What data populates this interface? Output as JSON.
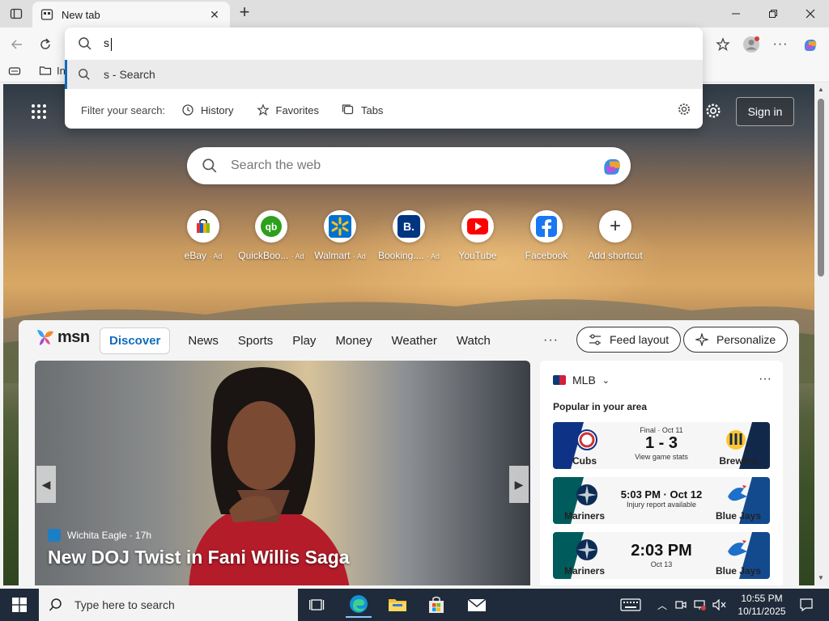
{
  "browser": {
    "tab_title": "New tab",
    "omnibox": {
      "query": "s",
      "suggestion": "s - Search",
      "filter_label": "Filter your search:",
      "filters": [
        "History",
        "Favorites",
        "Tabs"
      ]
    },
    "favbar_item": "In"
  },
  "newtab": {
    "search_placeholder": "Search the web",
    "sign_in": "Sign in",
    "shortcuts": [
      {
        "label": "eBay",
        "ad": "· Ad"
      },
      {
        "label": "QuickBoo...",
        "ad": "· Ad"
      },
      {
        "label": "Walmart",
        "ad": "· Ad"
      },
      {
        "label": "Booking....",
        "ad": "· Ad"
      },
      {
        "label": "YouTube",
        "ad": ""
      },
      {
        "label": "Facebook",
        "ad": ""
      },
      {
        "label": "Add shortcut",
        "ad": ""
      }
    ]
  },
  "msn": {
    "logo": "msn",
    "nav": [
      "Discover",
      "News",
      "Sports",
      "Play",
      "Money",
      "Weather",
      "Watch"
    ],
    "feed_layout": "Feed layout",
    "personalize": "Personalize",
    "hero": {
      "source": "Wichita Eagle · 17h",
      "headline": "New DOJ Twist in Fani Willis Saga"
    },
    "mlb": {
      "title": "MLB",
      "subtitle": "Popular in your area",
      "games": [
        {
          "left": "Cubs",
          "right": "Brewers",
          "top": "Final · Oct 11",
          "main": "1 - 3",
          "bottom": "View game stats"
        },
        {
          "left": "Mariners",
          "right": "Blue Jays",
          "top": "",
          "main": "5:03 PM · Oct 12",
          "bottom": "Injury report available"
        },
        {
          "left": "Mariners",
          "right": "Blue Jays",
          "top": "",
          "main": "2:03 PM",
          "bottom": "Oct 13"
        }
      ]
    }
  },
  "taskbar": {
    "search_placeholder": "Type here to search",
    "time": "10:55 PM",
    "date": "10/11/2025"
  },
  "colors": {
    "accent": "#0f6cbd",
    "taskbar": "#1f2b3a"
  }
}
